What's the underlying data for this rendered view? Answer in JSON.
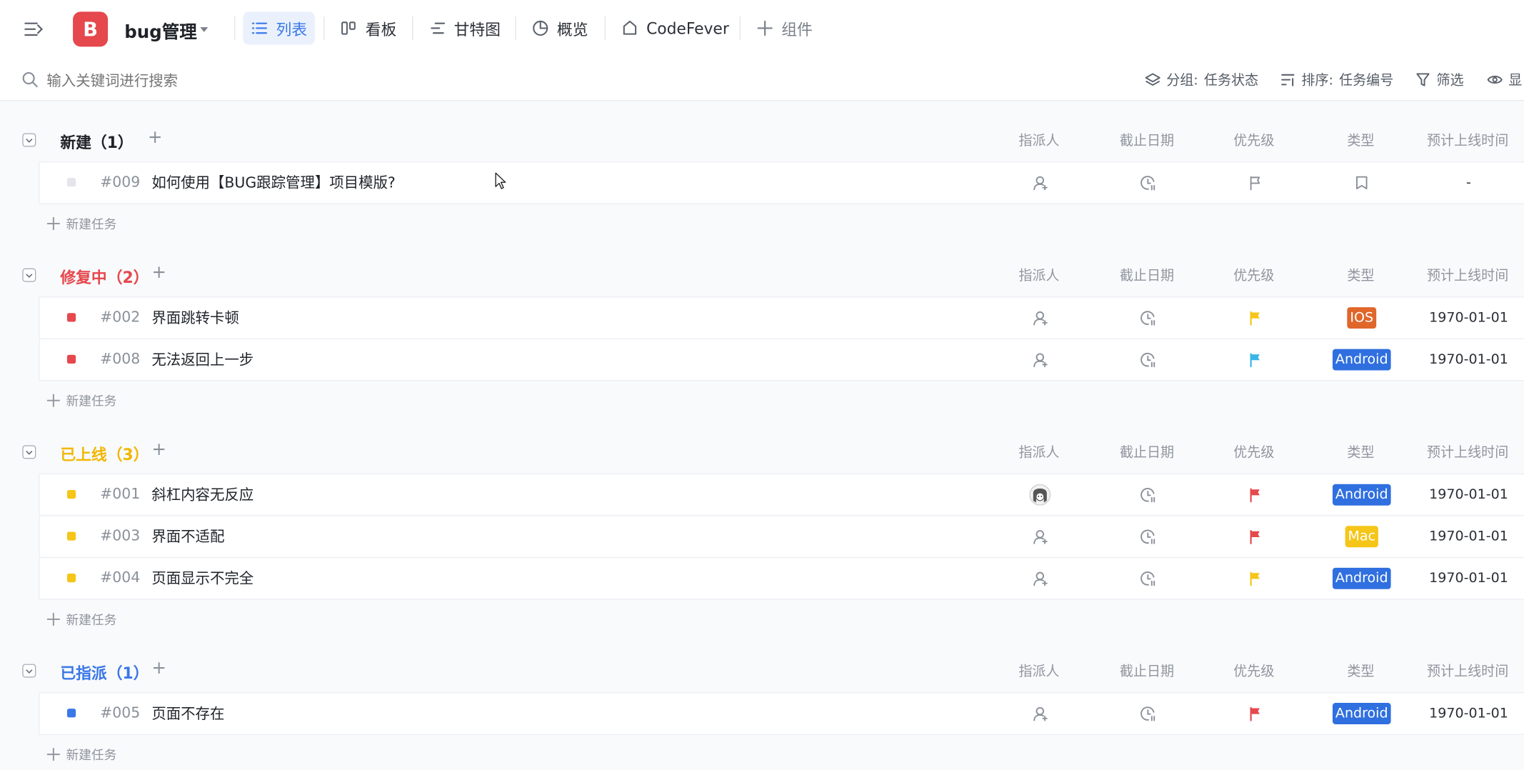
{
  "header": {
    "project_initial": "B",
    "project_name": "bug管理",
    "tabs": [
      {
        "label": "列表",
        "icon": "list-icon",
        "active": true
      },
      {
        "label": "看板",
        "icon": "board-icon"
      },
      {
        "label": "甘特图",
        "icon": "gantt-icon"
      },
      {
        "label": "概览",
        "icon": "overview-icon"
      },
      {
        "label": "CodeFever",
        "icon": "codefever-icon"
      },
      {
        "label": "组件",
        "icon": "plus-icon"
      }
    ]
  },
  "toolbar": {
    "search_placeholder": "输入关键词进行搜索",
    "group_label": "分组:",
    "group_value": "任务状态",
    "sort_label": "排序:",
    "sort_value": "任务编号",
    "filter_label": "筛选",
    "display_label": "显"
  },
  "columns": [
    "指派人",
    "截止日期",
    "优先级",
    "类型",
    "预计上线时间"
  ],
  "add_task_label": "新建任务",
  "groups": [
    {
      "title": "新建（1）",
      "color": "#1f2329",
      "status_color": "#e3e5ea",
      "tasks": [
        {
          "id": "#009",
          "title": "如何使用【BUG跟踪管理】项目模版?",
          "assignee": "none",
          "priority_color": null,
          "type_label": null,
          "type_color": null,
          "release": "-"
        }
      ]
    },
    {
      "title": "修复中（2）",
      "color": "#e5484d",
      "status_color": "#e5484d",
      "tasks": [
        {
          "id": "#002",
          "title": "界面跳转卡顿",
          "assignee": "none",
          "priority_color": "#f5c518",
          "type_label": "IOS",
          "type_color": "#e0662a",
          "release": "1970-01-01"
        },
        {
          "id": "#008",
          "title": "无法返回上一步",
          "assignee": "none",
          "priority_color": "#3bb5e8",
          "type_label": "Android",
          "type_color": "#2f6fe0",
          "release": "1970-01-01"
        }
      ]
    },
    {
      "title": "已上线（3）",
      "color": "#f2b705",
      "status_color": "#f5c518",
      "tasks": [
        {
          "id": "#001",
          "title": "斜杠内容无反应",
          "assignee": "avatar",
          "priority_color": "#e5484d",
          "type_label": "Android",
          "type_color": "#2f6fe0",
          "release": "1970-01-01"
        },
        {
          "id": "#003",
          "title": "界面不适配",
          "assignee": "none",
          "priority_color": "#e5484d",
          "type_label": "Mac",
          "type_color": "#f5c518",
          "release": "1970-01-01"
        },
        {
          "id": "#004",
          "title": "页面显示不完全",
          "assignee": "none",
          "priority_color": "#f5c518",
          "type_label": "Android",
          "type_color": "#2f6fe0",
          "release": "1970-01-01"
        }
      ]
    },
    {
      "title": "已指派（1）",
      "color": "#3a78e8",
      "status_color": "#3a78e8",
      "tasks": [
        {
          "id": "#005",
          "title": "页面不存在",
          "assignee": "none",
          "priority_color": "#e5484d",
          "type_label": "Android",
          "type_color": "#2f6fe0",
          "release": "1970-01-01"
        }
      ]
    }
  ]
}
